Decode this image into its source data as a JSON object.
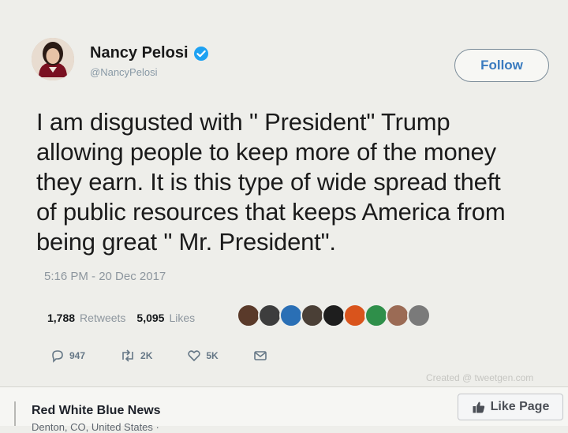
{
  "tweet": {
    "display_name": "Nancy Pelosi",
    "handle": "@NancyPelosi",
    "follow_label": "Follow",
    "lines": [
      "I am disgusted with \" President\" Trump",
      "allowing people to keep more of the money",
      "they earn.  It is this type of wide spread theft",
      "of public resources that keeps America from",
      "being great \" Mr. President\"."
    ],
    "timestamp": "5:16 PM - 20 Dec 2017",
    "retweets_count": "1,788",
    "retweets_label": "Retweets",
    "likes_count": "5,095",
    "likes_label": "Likes",
    "replies": "947",
    "retweets_short": "2K",
    "likes_short": "5K"
  },
  "liker_avatars": [
    {
      "icon": "avatar-icon",
      "color": "#5a3a2a"
    },
    {
      "icon": "avatar-icon",
      "color": "#3d3d3d"
    },
    {
      "icon": "avatar-icon",
      "color": "#2a6fb5"
    },
    {
      "icon": "avatar-icon",
      "color": "#4a3f36"
    },
    {
      "icon": "avatar-icon",
      "color": "#1e1e1e"
    },
    {
      "icon": "avatar-icon",
      "color": "#d9541c"
    },
    {
      "icon": "avatar-icon",
      "color": "#2f8f4a"
    },
    {
      "icon": "avatar-icon",
      "color": "#9b6b55"
    },
    {
      "icon": "avatar-icon",
      "color": "#7a7a7a"
    }
  ],
  "footer": {
    "page_name": "Red White Blue News",
    "location_partial": "Denton, CO, United States · ",
    "like_page_label": "Like Page"
  },
  "colors": {
    "accent": "#1da1f2",
    "text": "#14171a",
    "muted": "#8d969e"
  }
}
